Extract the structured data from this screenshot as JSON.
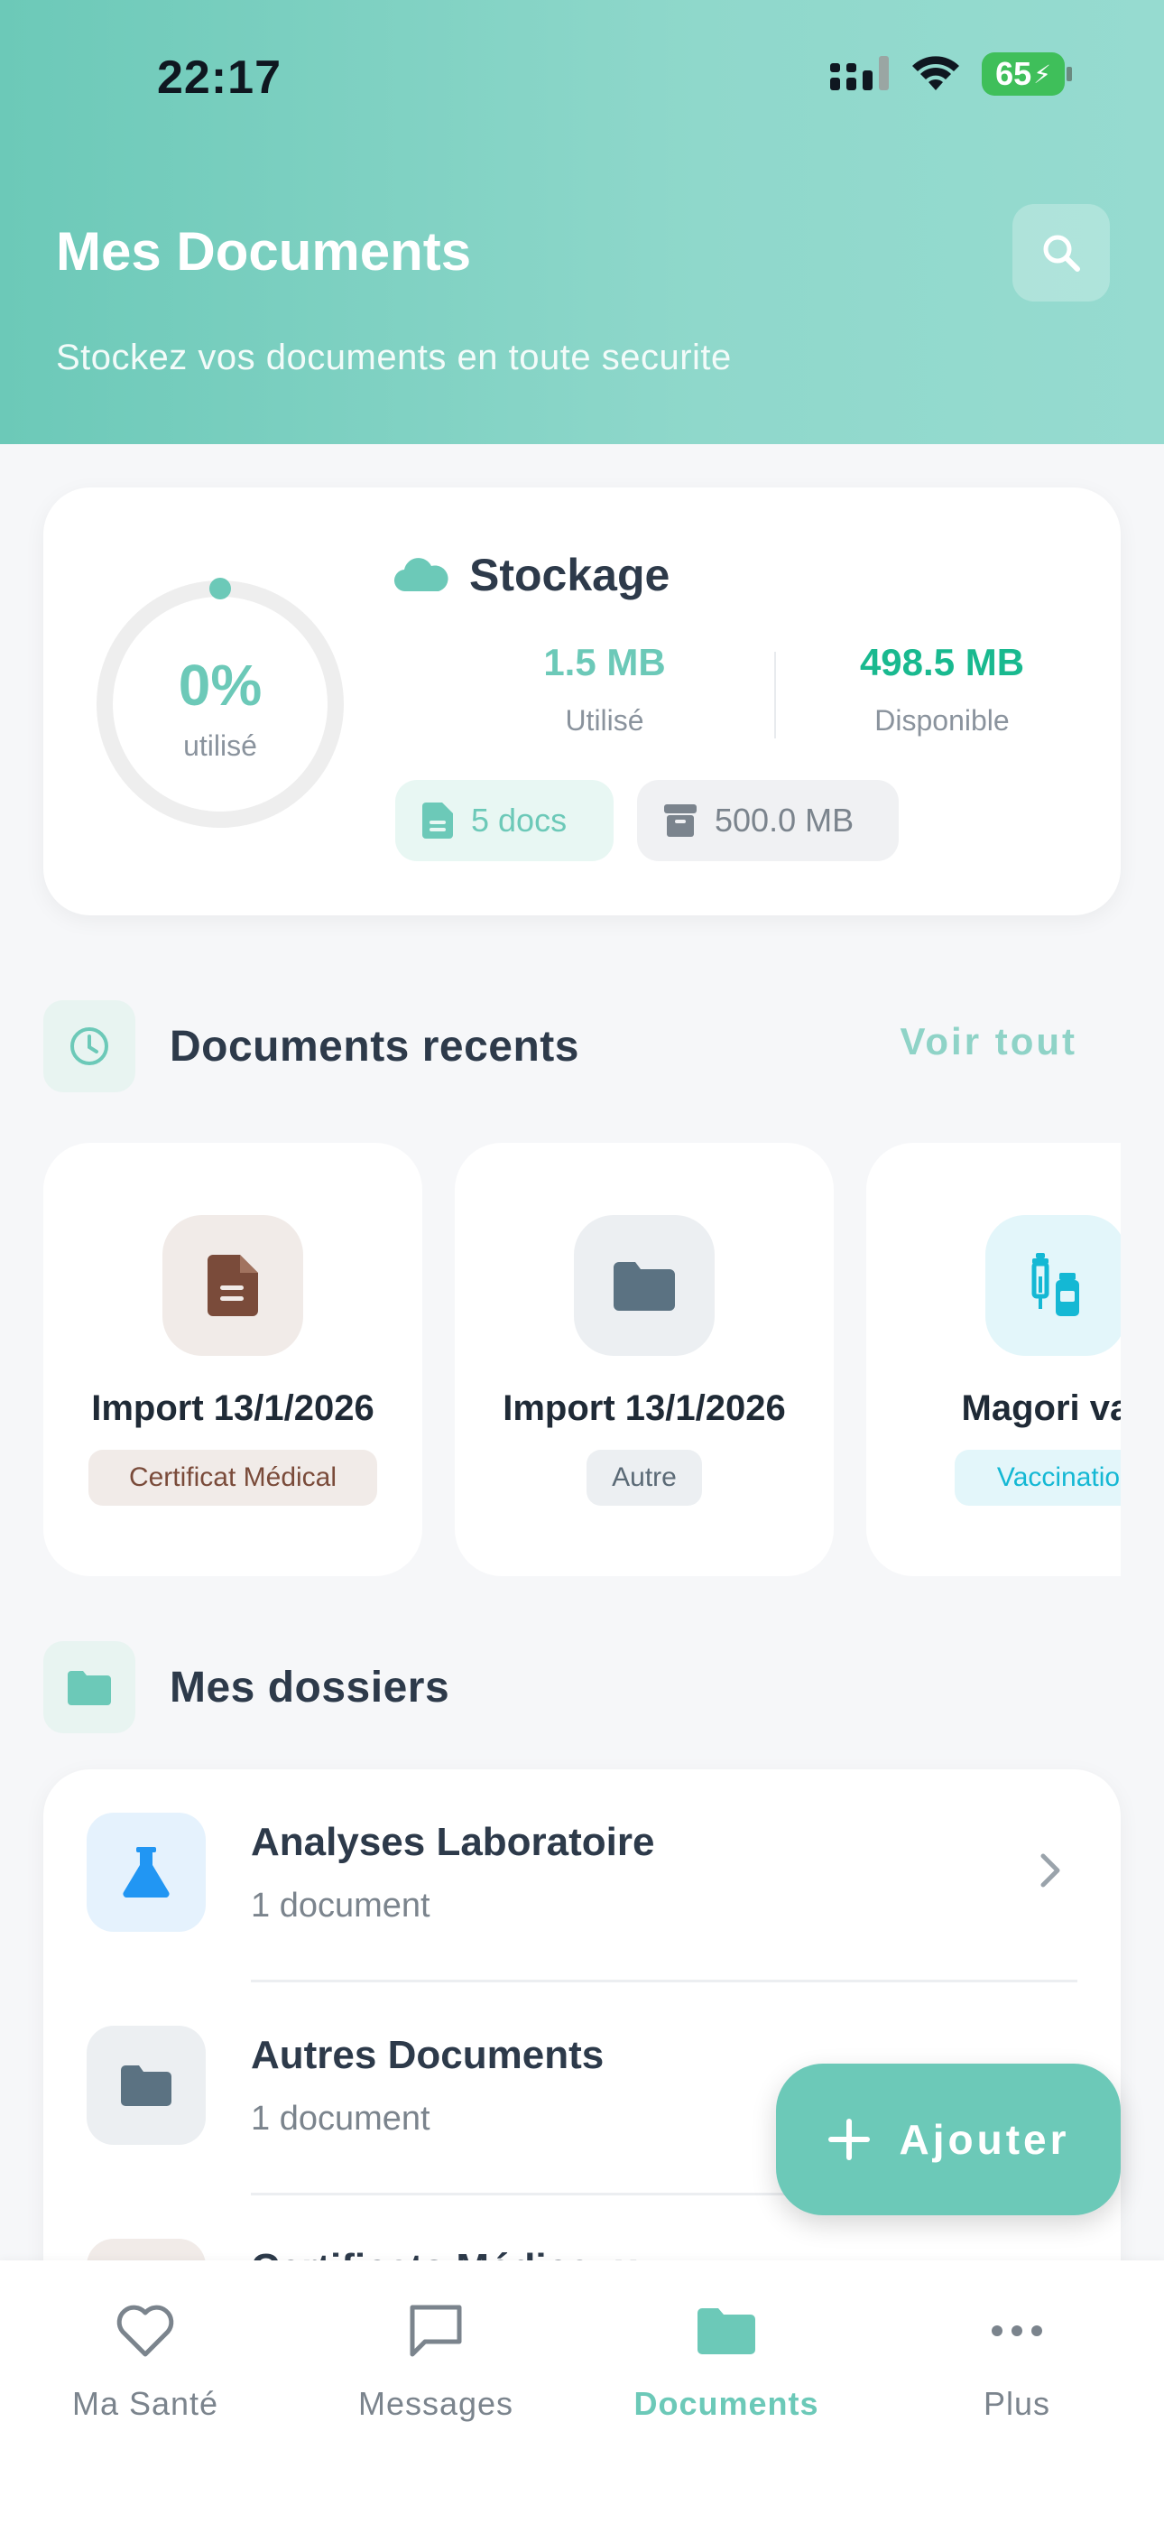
{
  "status_bar": {
    "time": "22:17",
    "battery": "65"
  },
  "header": {
    "title": "Mes Documents",
    "subtitle": "Stockez vos documents en toute securite"
  },
  "storage": {
    "title": "Stockage",
    "percent_label": "0%",
    "percent_caption": "utilisé",
    "used_fraction": 0.003,
    "used_value": "1.5 MB",
    "used_label": "Utilisé",
    "available_value": "498.5 MB",
    "available_label": "Disponible",
    "docs_chip": "5 docs",
    "capacity_chip": "500.0 MB"
  },
  "recent": {
    "title": "Documents recents",
    "see_all": "Voir tout",
    "items": [
      {
        "name": "Import 13/1/2026",
        "tag": "Certificat Médical",
        "icon": "document-icon"
      },
      {
        "name": "Import 13/1/2026",
        "tag": "Autre",
        "icon": "folder-icon"
      },
      {
        "name": "Magori vac",
        "tag": "Vaccinatio",
        "icon": "vaccine-icon"
      }
    ]
  },
  "folders": {
    "title": "Mes dossiers",
    "items": [
      {
        "title": "Analyses Laboratoire",
        "count": "1 document",
        "icon": "flask-icon"
      },
      {
        "title": "Autres Documents",
        "count": "1 document",
        "icon": "folder-icon"
      },
      {
        "title": "Certificats Médicaux",
        "count": "",
        "icon": "document-icon"
      }
    ]
  },
  "fab": {
    "label": "Ajouter"
  },
  "nav": {
    "items": [
      {
        "label": "Ma Santé",
        "icon": "heart-icon",
        "active": false
      },
      {
        "label": "Messages",
        "icon": "message-icon",
        "active": false
      },
      {
        "label": "Documents",
        "icon": "folder-icon",
        "active": true
      },
      {
        "label": "Plus",
        "icon": "more-icon",
        "active": false
      }
    ]
  },
  "colors": {
    "accent": "#6cc9b8",
    "available_green": "#19b98f",
    "lab_blue": "#2196f3",
    "cert_brown": "#7a4b3a",
    "vaccine_cyan": "#14b8d4",
    "folder_slate": "#5b7282"
  }
}
